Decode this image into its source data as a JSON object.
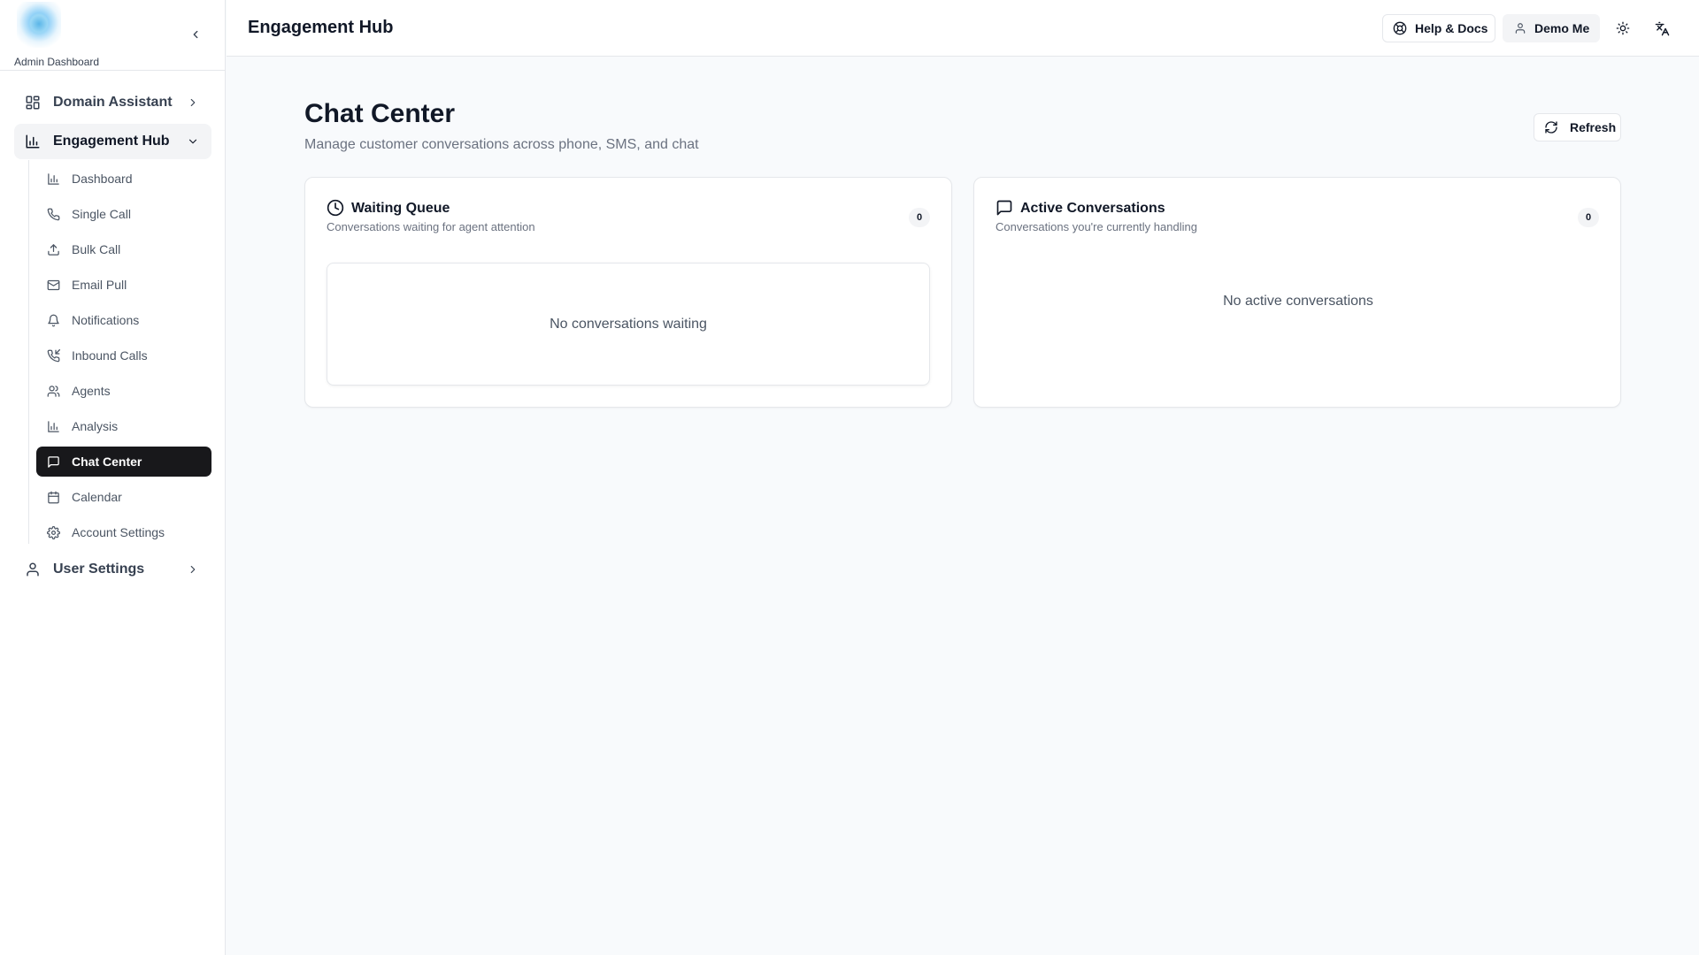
{
  "brand": {
    "label": "Admin Dashboard"
  },
  "sidebar": {
    "top_items": [
      {
        "label": "Domain Assistant",
        "icon": "layout-grid-icon",
        "expanded": false
      },
      {
        "label": "Engagement Hub",
        "icon": "bar-chart-icon",
        "expanded": true
      },
      {
        "label": "User Settings",
        "icon": "user-icon",
        "expanded": false
      }
    ],
    "sub_items": [
      {
        "label": "Dashboard",
        "icon": "bar-chart-icon"
      },
      {
        "label": "Single Call",
        "icon": "phone-icon"
      },
      {
        "label": "Bulk Call",
        "icon": "upload-icon"
      },
      {
        "label": "Email Pull",
        "icon": "mail-icon"
      },
      {
        "label": "Notifications",
        "icon": "bell-icon"
      },
      {
        "label": "Inbound Calls",
        "icon": "phone-incoming-icon"
      },
      {
        "label": "Agents",
        "icon": "users-icon"
      },
      {
        "label": "Analysis",
        "icon": "bar-chart-icon"
      },
      {
        "label": "Chat Center",
        "icon": "message-square-icon",
        "active": true
      },
      {
        "label": "Calendar",
        "icon": "calendar-icon"
      },
      {
        "label": "Account Settings",
        "icon": "gear-icon"
      }
    ]
  },
  "header": {
    "title": "Engagement Hub",
    "help_label": "Help & Docs",
    "user_label": "Demo Me"
  },
  "main": {
    "title": "Chat Center",
    "subtitle": "Manage customer conversations across phone, SMS, and chat",
    "refresh_label": "Refresh",
    "waiting_queue": {
      "title": "Waiting Queue",
      "description": "Conversations waiting for agent attention",
      "count": "0",
      "empty_text": "No conversations waiting"
    },
    "active_conversations": {
      "title": "Active Conversations",
      "description": "Conversations you're currently handling",
      "count": "0",
      "empty_text": "No active conversations"
    }
  },
  "colors": {
    "active_nav_bg": "#18181b",
    "page_bg": "#f8fafc",
    "border": "#e5e7eb"
  }
}
